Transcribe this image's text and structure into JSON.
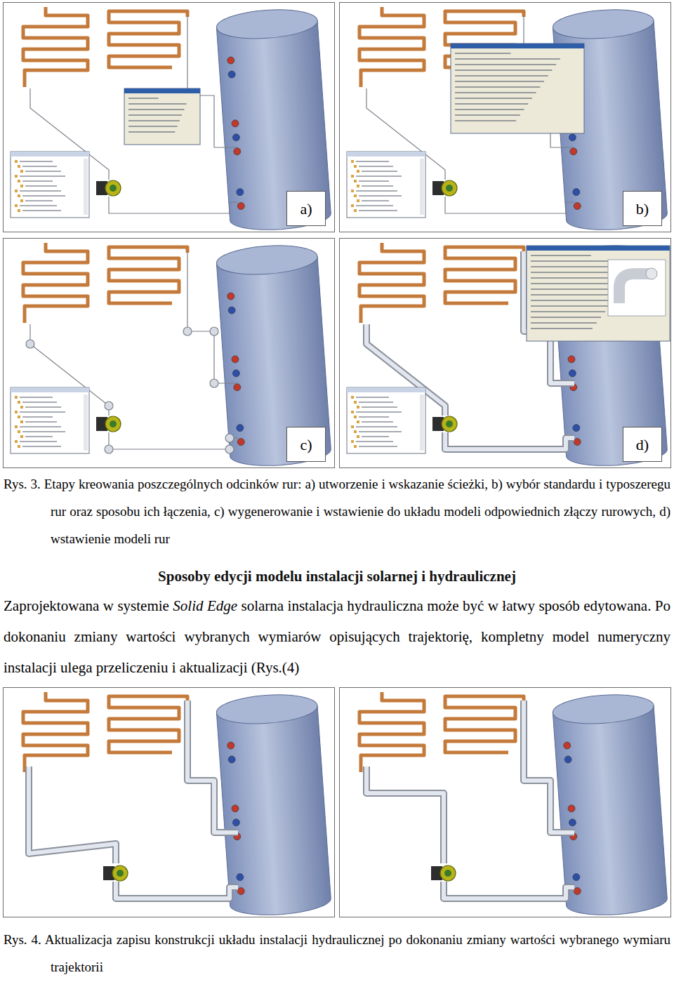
{
  "figure3": {
    "panels": [
      {
        "label": "a)",
        "kind": "path"
      },
      {
        "label": "b)",
        "kind": "options"
      },
      {
        "label": "c)",
        "kind": "fittings"
      },
      {
        "label": "d)",
        "kind": "pipes"
      }
    ],
    "caption": {
      "number": "Rys. 3.",
      "text": "Etapy kreowania poszczególnych odcinków rur: a) utworzenie i wskazanie ścieżki, b) wybór standardu i typoszeregu rur oraz sposobu ich łączenia, c) wygenerowanie i wstawienie do układu modeli odpowiednich złączy rurowych, d) wstawienie modeli rur"
    }
  },
  "section": {
    "heading": "Sposoby edycji modelu instalacji solarnej i hydraulicznej",
    "paragraph": [
      {
        "text": "Zaprojektowana w systemie ",
        "italic": false
      },
      {
        "text": "Solid Edge",
        "italic": true
      },
      {
        "text": " solarna instalacja hydrauliczna może być w łatwy sposób edytowana. Po dokonaniu zmiany wartości wybranych wymiarów opisujących trajektorię, kompletny model numeryczny instalacji ulega przeliczeniu i aktualizacji (Rys.(4)",
        "italic": false
      }
    ]
  },
  "figure4": {
    "panels": [
      {
        "kind": "edited"
      },
      {
        "kind": "moved"
      }
    ],
    "caption": {
      "number": "Rys. 4.",
      "text": "Aktualizacja zapisu konstrukcji układu instalacji hydraulicznej po dokonaniu zmiany wartości wybranego wymiaru trajektorii"
    }
  }
}
